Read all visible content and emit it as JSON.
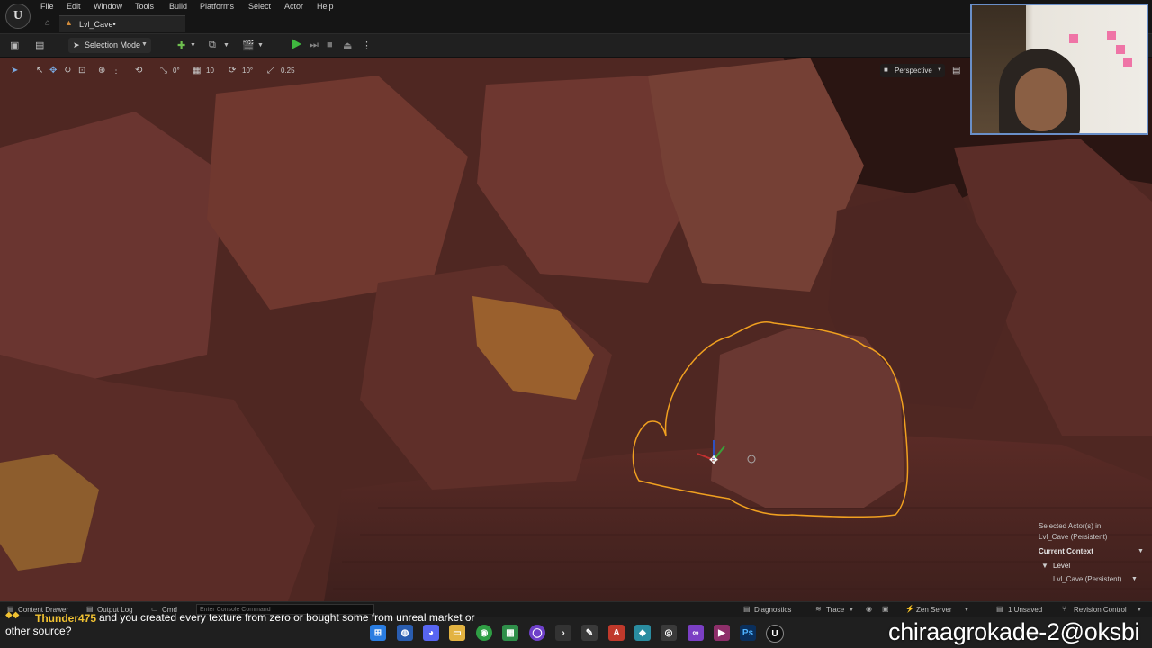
{
  "menubar": {
    "items": [
      "File",
      "Edit",
      "Window",
      "Tools",
      "Build",
      "Platforms",
      "Select",
      "Actor",
      "Help"
    ]
  },
  "tab": {
    "label": "Lvl_Cave•"
  },
  "toolbar": {
    "selection_mode": "Selection Mode"
  },
  "viewport_toolbar": {
    "rotate_snap": "0°",
    "grid_snap": "10",
    "angle_snap": "10°",
    "scale_snap": "0.25",
    "view_mode": "Perspective"
  },
  "selected_info": {
    "line1": "Selected Actor(s) in",
    "line2": "Lvl_Cave (Persistent)",
    "context_label": "Current Context",
    "level_label": "Level",
    "level_value": "Lvl_Cave (Persistent)"
  },
  "statusbar": {
    "content_drawer": "Content Drawer",
    "output_log": "Output Log",
    "cmd": "Cmd",
    "console_placeholder": "Enter Console Command",
    "diagnostics": "Diagnostics",
    "trace": "Trace",
    "zen_server": "Zen Server",
    "unsaved": "1 Unsaved",
    "revision_control": "Revision Control"
  },
  "chat": {
    "user": "Thunder475",
    "message_line1": "and you created every texture from zero or bought some from unreal market or",
    "message_line2": "other source?"
  },
  "watermark": "chiraagrokade-2@oksbi",
  "colors": {
    "selection_outline": "#f0a020",
    "play_green": "#3fb83f",
    "chat_user": "#f1c232",
    "accent_orange": "#d08a3a"
  }
}
